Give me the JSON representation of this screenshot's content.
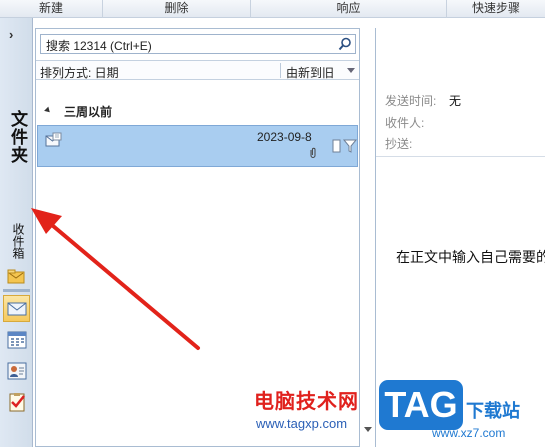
{
  "ribbon": {
    "groups": [
      "新建",
      "删除",
      "响应",
      "快速步骤"
    ]
  },
  "nav": {
    "expand_glyph": "›",
    "folder_label": "文件夹",
    "inbox_label": "收件箱",
    "buttons": [
      "mail-icon",
      "calendar-icon",
      "contacts-icon",
      "tasks-icon"
    ]
  },
  "list": {
    "search_text": "搜索 12314 (Ctrl+E)",
    "sort_label": "排列方式: 日期",
    "sort_order": "由新到旧",
    "group_label": "三周以前",
    "rows": [
      {
        "date": "2023-09-8",
        "has_attachment": true,
        "icon": "message-envelope-icon"
      }
    ]
  },
  "reading": {
    "sent_label": "发送时间:",
    "sent_value": "无",
    "to_label": "收件人:",
    "cc_label": "抄送:",
    "body_text": "在正文中输入自己需要的"
  },
  "watermark": {
    "site_name": "电脑技术网",
    "site_url": "www.tagxp.com",
    "tag_logo": "TAG",
    "download_text": "下载站",
    "download_url": "www.xz7.com"
  },
  "colors": {
    "selection": "#a9cdf0",
    "annotation_arrow": "#e2231a",
    "tag_blue": "#1f79d1"
  }
}
